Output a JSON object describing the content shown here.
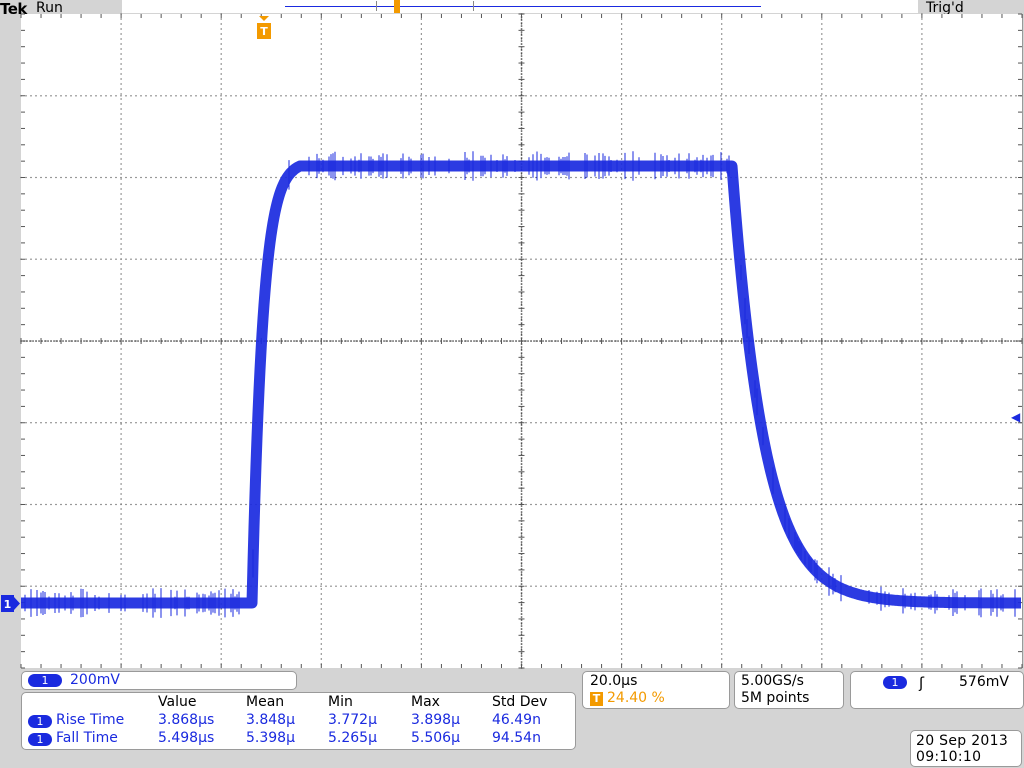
{
  "header": {
    "brand": "Tek",
    "run_state": "Run",
    "trigger_state": "Trig'd"
  },
  "markers": {
    "trigger_marker_label": "T",
    "channel_marker_label": "1",
    "trigger_level_arrow": "◀"
  },
  "colors": {
    "trace": "#1a2adf",
    "trigger": "#f39a00",
    "grid": "#555555"
  },
  "channel": {
    "number": "1",
    "scale": "200mV"
  },
  "timebase": {
    "scale": "20.0µs",
    "trigger_icon": "T",
    "trigger_position": "24.40 %"
  },
  "acquisition": {
    "sample_rate": "5.00GS/s",
    "record_length": "5M points"
  },
  "trigger": {
    "source": "1",
    "edge_icon": "rising-edge-icon",
    "edge_glyph": "ʃ",
    "level": "576mV"
  },
  "measurements": {
    "headers": [
      "Value",
      "Mean",
      "Min",
      "Max",
      "Std Dev"
    ],
    "rows": [
      {
        "source": "1",
        "label": "Rise Time",
        "values": [
          "3.868µs",
          "3.848µ",
          "3.772µ",
          "3.898µ",
          "46.49n"
        ]
      },
      {
        "source": "1",
        "label": "Fall Time",
        "values": [
          "5.498µs",
          "5.398µ",
          "5.265µ",
          "5.506µ",
          "94.54n"
        ]
      }
    ]
  },
  "datetime": {
    "date": "20 Sep  2013",
    "time": "09:10:10"
  }
}
